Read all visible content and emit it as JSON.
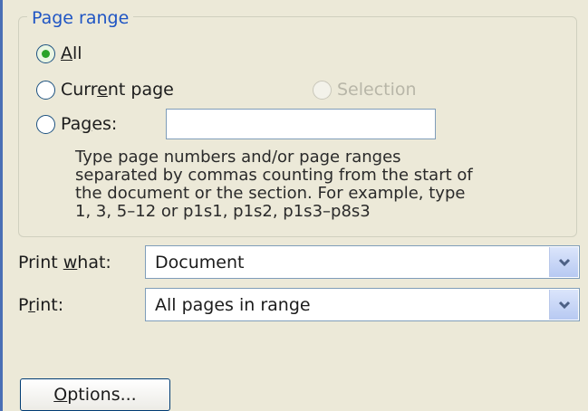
{
  "page_range": {
    "legend": "Page range",
    "all": {
      "before": "",
      "mn": "A",
      "after": "ll",
      "checked": true
    },
    "current_page": {
      "before": "Curr",
      "mn": "e",
      "after": "nt page",
      "checked": false
    },
    "selection": {
      "label": "Selection",
      "enabled": false
    },
    "pages": {
      "before": "Pa",
      "mn": "g",
      "after": "es:",
      "checked": false,
      "value": ""
    },
    "hint_lines": [
      "Type page numbers and/or page ranges",
      "separated by commas counting from the start of",
      "the document or the section. For example, type",
      "1, 3, 5–12 or p1s1, p1s2, p1s3–p8s3"
    ]
  },
  "print_what": {
    "label_before": "Print ",
    "label_mn": "w",
    "label_after": "hat:",
    "value": "Document",
    "icon": "chevron-down-icon"
  },
  "print": {
    "label_before": "P",
    "label_mn": "r",
    "label_after": "int:",
    "value": "All pages in range",
    "icon": "chevron-down-icon"
  },
  "options_button": {
    "label_mn": "O",
    "label_after": "ptions..."
  },
  "colors": {
    "accent": "#1f55c4",
    "radio_dot": "#2aa32a",
    "window_bg": "#ece9d8"
  }
}
